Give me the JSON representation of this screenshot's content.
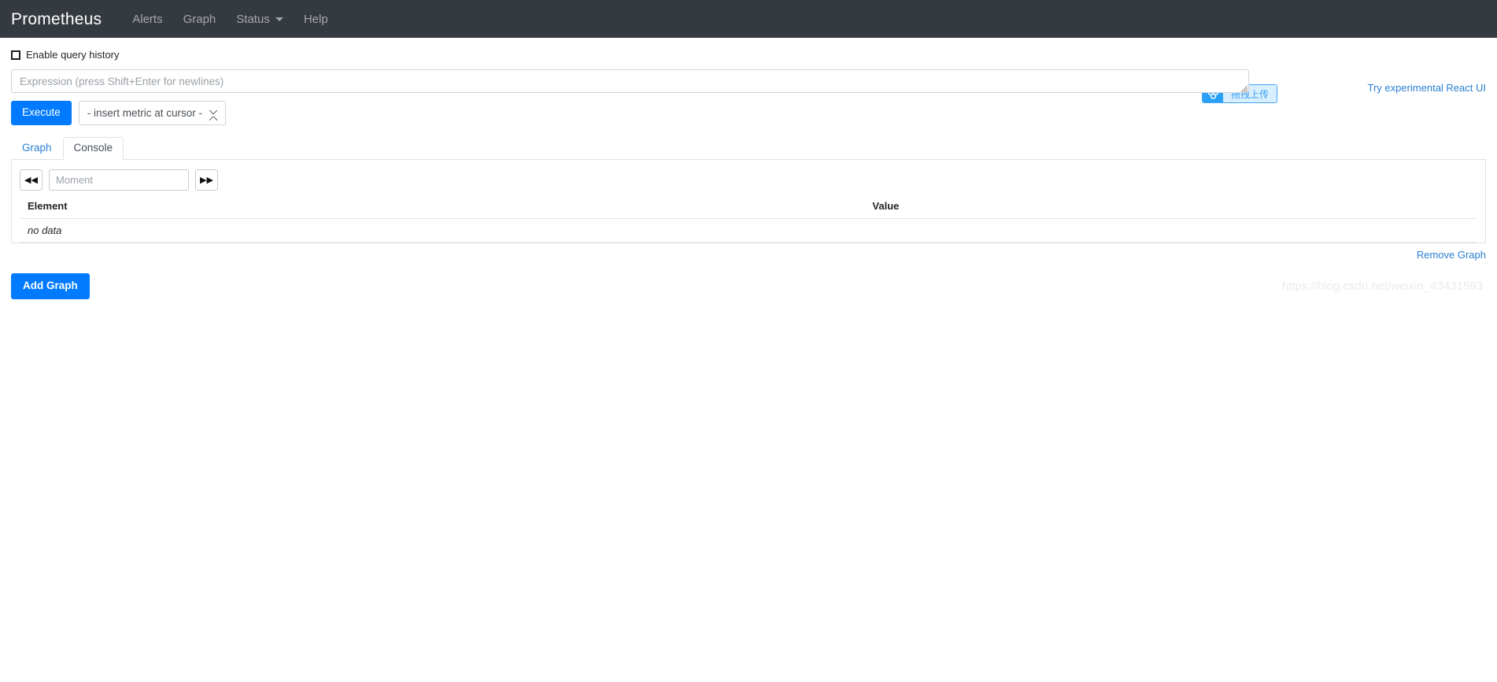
{
  "navbar": {
    "brand": "Prometheus",
    "background": "#343a40",
    "items": [
      {
        "label": "Alerts",
        "name": "alerts",
        "has_caret": false
      },
      {
        "label": "Graph",
        "name": "graph",
        "has_caret": false
      },
      {
        "label": "Status",
        "name": "status",
        "has_caret": true
      },
      {
        "label": "Help",
        "name": "help",
        "has_caret": false
      }
    ]
  },
  "query": {
    "history_checkbox_label": "Enable query history",
    "history_checked": false,
    "expression_placeholder": "Expression (press Shift+Enter for newlines)",
    "expression_value": "",
    "execute_label": "Execute",
    "metric_select_value": "- insert metric at cursor -"
  },
  "upload_widget": {
    "label": "拖拽上传",
    "icon": "baidu-netdisk-icon",
    "icon_background": "#2ba0f8",
    "text_background": "#d9effd",
    "text_color": "#3ea2f5"
  },
  "react_ui_link": {
    "label": "Try experimental React UI",
    "color": "#2a7fd4"
  },
  "tabs": [
    {
      "label": "Graph",
      "name": "graph",
      "active": false
    },
    {
      "label": "Console",
      "name": "console",
      "active": true
    }
  ],
  "console": {
    "prev_button_icon": "double-chevron-left-icon",
    "next_button_icon": "double-chevron-right-icon",
    "moment_placeholder": "Moment",
    "moment_value": "",
    "table": {
      "columns": [
        "Element",
        "Value"
      ],
      "rows": [],
      "empty_message": "no data"
    }
  },
  "actions": {
    "remove_graph_label": "Remove Graph",
    "add_graph_label": "Add Graph",
    "primary_color": "#007bff"
  },
  "watermark": "https://blog.csdn.net/weixin_43431593"
}
